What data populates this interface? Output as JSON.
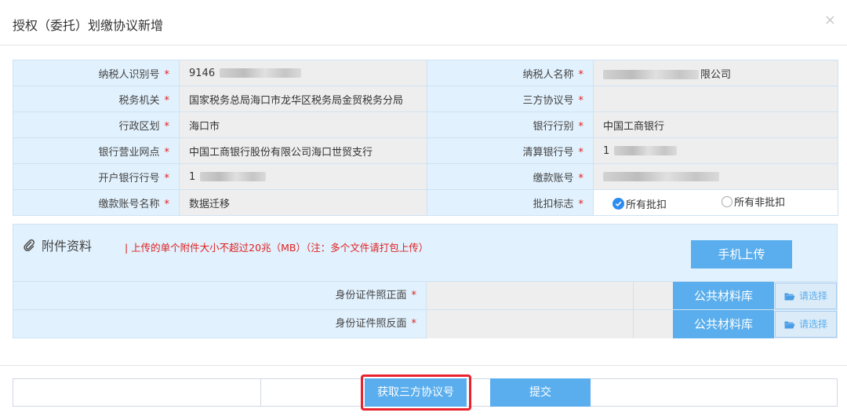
{
  "modal": {
    "title": "授权（委托）划缴协议新增",
    "close": "×"
  },
  "form": {
    "required_mark": "*",
    "rows": [
      {
        "label1": "纳税人识别号",
        "value1": "9146",
        "label2": "纳税人名称",
        "value2": "限公司"
      },
      {
        "label1": "税务机关",
        "value1": "国家税务总局海口市龙华区税务局金贸税务分局",
        "label2": "三方协议号",
        "value2": ""
      },
      {
        "label1": "行政区划",
        "value1": "海口市",
        "label2": "银行行别",
        "value2": "中国工商银行"
      },
      {
        "label1": "银行营业网点",
        "value1": "中国工商银行股份有限公司海口世贸支行",
        "label2": "清算银行号",
        "value2": "1"
      },
      {
        "label1": "开户银行行号",
        "value1": "1",
        "label2": "缴款账号",
        "value2": ""
      },
      {
        "label1": "缴款账号名称",
        "value1": "数据迁移",
        "label2": "批扣标志",
        "value2": ""
      }
    ],
    "deduct_options": [
      {
        "label": "所有批扣",
        "checked": true
      },
      {
        "label": "所有非批扣",
        "checked": false
      }
    ]
  },
  "attachments": {
    "title": "附件资料",
    "note": "| 上传的单个附件大小不超过20兆（MB）（注：多个文件请打包上传）",
    "mobile_upload": "手机上传",
    "rows": [
      {
        "label": "身份证件照正面",
        "library": "公共材料库",
        "choose": "请选择"
      },
      {
        "label": "身份证件照反面",
        "library": "公共材料库",
        "choose": "请选择"
      }
    ]
  },
  "footer": {
    "get_agreement": "获取三方协议号",
    "submit": "提交"
  },
  "colors": {
    "button": "#5aaeed",
    "label_bg": "#e1f1fd",
    "value_bg": "#eeeeee",
    "required": "#e02020",
    "highlight": "#e8232d"
  },
  "icons": [
    "close-icon",
    "paperclip-icon",
    "radio-checked-icon",
    "radio-unchecked-icon",
    "folder-open-icon"
  ]
}
